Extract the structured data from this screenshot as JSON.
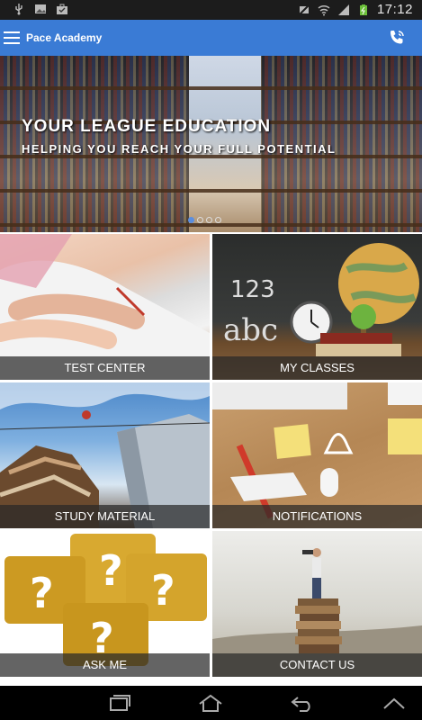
{
  "status_bar": {
    "time": "17:12",
    "left_icons": [
      "usb-icon",
      "image-icon",
      "briefcase-icon"
    ],
    "right_icons": [
      "mute-icon",
      "wifi-icon",
      "signal-icon",
      "battery-icon"
    ]
  },
  "app_bar": {
    "title": "Pace Academy",
    "menu_icon": "hamburger-menu-icon",
    "call_icon": "phone-call-icon",
    "color": "#3a7bd5"
  },
  "banner": {
    "title": "YOUR LEAGUE EDUCATION",
    "subtitle": "HELPING YOU REACH YOUR FULL POTENTIAL",
    "page_count": 4,
    "active_page": 1
  },
  "tiles": [
    {
      "label": "TEST CENTER"
    },
    {
      "label": "MY CLASSES"
    },
    {
      "label": "STUDY MATERIAL"
    },
    {
      "label": "NOTIFICATIONS"
    },
    {
      "label": "ASK ME"
    },
    {
      "label": "CONTACT US"
    }
  ],
  "nav_bar": {
    "buttons": [
      "recent-apps-icon",
      "home-icon",
      "back-icon",
      "menu-up-icon"
    ]
  }
}
